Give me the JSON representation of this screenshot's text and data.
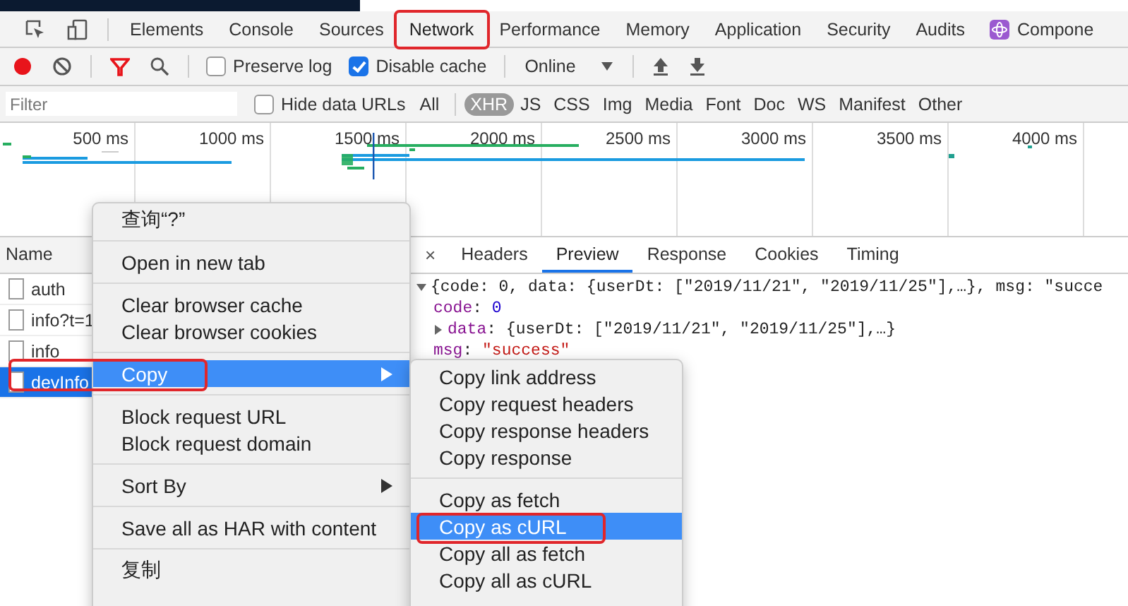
{
  "tabs": [
    {
      "label": "Elements",
      "selected": false,
      "highlighted": false
    },
    {
      "label": "Console",
      "selected": false,
      "highlighted": false
    },
    {
      "label": "Sources",
      "selected": false,
      "highlighted": false
    },
    {
      "label": "Network",
      "selected": true,
      "highlighted": true
    },
    {
      "label": "Performance",
      "selected": false,
      "highlighted": false
    },
    {
      "label": "Memory",
      "selected": false,
      "highlighted": false
    },
    {
      "label": "Application",
      "selected": false,
      "highlighted": false
    },
    {
      "label": "Security",
      "selected": false,
      "highlighted": false
    },
    {
      "label": "Audits",
      "selected": false,
      "highlighted": false
    },
    {
      "label": "Compone",
      "selected": false,
      "highlighted": false
    }
  ],
  "toolbar": {
    "recording": true,
    "preserve_log": {
      "label": "Preserve log",
      "checked": false
    },
    "disable_cache": {
      "label": "Disable cache",
      "checked": true
    },
    "throttling": "Online"
  },
  "filter_bar": {
    "placeholder": "Filter",
    "hide_data_urls": {
      "label": "Hide data URLs",
      "checked": false
    },
    "all": "All",
    "types": [
      {
        "label": "XHR",
        "selected": true
      },
      {
        "label": "JS",
        "selected": false
      },
      {
        "label": "CSS",
        "selected": false
      },
      {
        "label": "Img",
        "selected": false
      },
      {
        "label": "Media",
        "selected": false
      },
      {
        "label": "Font",
        "selected": false
      },
      {
        "label": "Doc",
        "selected": false
      },
      {
        "label": "WS",
        "selected": false
      },
      {
        "label": "Manifest",
        "selected": false
      },
      {
        "label": "Other",
        "selected": false
      }
    ]
  },
  "overview": {
    "ticks": [
      "500 ms",
      "1000 ms",
      "1500 ms",
      "2000 ms",
      "2500 ms",
      "3000 ms",
      "3500 ms",
      "4000 ms"
    ]
  },
  "requests": {
    "header": "Name",
    "rows": [
      {
        "name": "auth",
        "selected": false
      },
      {
        "name": "info?t=1",
        "selected": false
      },
      {
        "name": "info",
        "selected": false
      },
      {
        "name": "devInfo",
        "selected": true
      }
    ]
  },
  "detail_tabs": {
    "close": "×",
    "tabs": [
      {
        "label": "Headers",
        "selected": false
      },
      {
        "label": "Preview",
        "selected": true
      },
      {
        "label": "Response",
        "selected": false
      },
      {
        "label": "Cookies",
        "selected": false
      },
      {
        "label": "Timing",
        "selected": false
      }
    ]
  },
  "preview": [
    {
      "kind": "summary",
      "expanded": true,
      "text": "{code: 0, data: {userDt: [\"2019/11/21\", \"2019/11/25\"],…}, msg: \"succe"
    },
    {
      "kind": "number",
      "key": "code",
      "sep": ":",
      "value": "0"
    },
    {
      "kind": "object",
      "expanded": false,
      "key": "data",
      "sep": ":",
      "value": "{userDt: [\"2019/11/21\", \"2019/11/25\"],…}"
    },
    {
      "kind": "string",
      "key": "msg",
      "sep": ":",
      "value": "\"success\""
    }
  ],
  "context_menu": {
    "groups": [
      [
        {
          "label": "查询“?”",
          "selected": false,
          "submenu": false,
          "highlighted": false
        }
      ],
      [
        {
          "label": "Open in new tab",
          "selected": false,
          "submenu": false,
          "highlighted": false
        }
      ],
      [
        {
          "label": "Clear browser cache",
          "selected": false,
          "submenu": false,
          "highlighted": false
        },
        {
          "label": "Clear browser cookies",
          "selected": false,
          "submenu": false,
          "highlighted": false
        }
      ],
      [
        {
          "label": "Copy",
          "selected": true,
          "submenu": true,
          "highlighted": true
        }
      ],
      [
        {
          "label": "Block request URL",
          "selected": false,
          "submenu": false,
          "highlighted": false
        },
        {
          "label": "Block request domain",
          "selected": false,
          "submenu": false,
          "highlighted": false
        }
      ],
      [
        {
          "label": "Sort By",
          "selected": false,
          "submenu": true,
          "highlighted": false
        }
      ],
      [
        {
          "label": "Save all as HAR with content",
          "selected": false,
          "submenu": false,
          "highlighted": false
        }
      ],
      [
        {
          "label": "复制",
          "selected": false,
          "submenu": false,
          "highlighted": false
        }
      ]
    ]
  },
  "copy_submenu": {
    "groups": [
      [
        {
          "label": "Copy link address",
          "selected": false,
          "highlighted": false
        },
        {
          "label": "Copy request headers",
          "selected": false,
          "highlighted": false
        },
        {
          "label": "Copy response headers",
          "selected": false,
          "highlighted": false
        },
        {
          "label": "Copy response",
          "selected": false,
          "highlighted": false
        }
      ],
      [
        {
          "label": "Copy as fetch",
          "selected": false,
          "highlighted": false
        },
        {
          "label": "Copy as cURL",
          "selected": true,
          "highlighted": true
        },
        {
          "label": "Copy all as fetch",
          "selected": false,
          "highlighted": false
        },
        {
          "label": "Copy all as cURL",
          "selected": false,
          "highlighted": false
        }
      ]
    ]
  }
}
